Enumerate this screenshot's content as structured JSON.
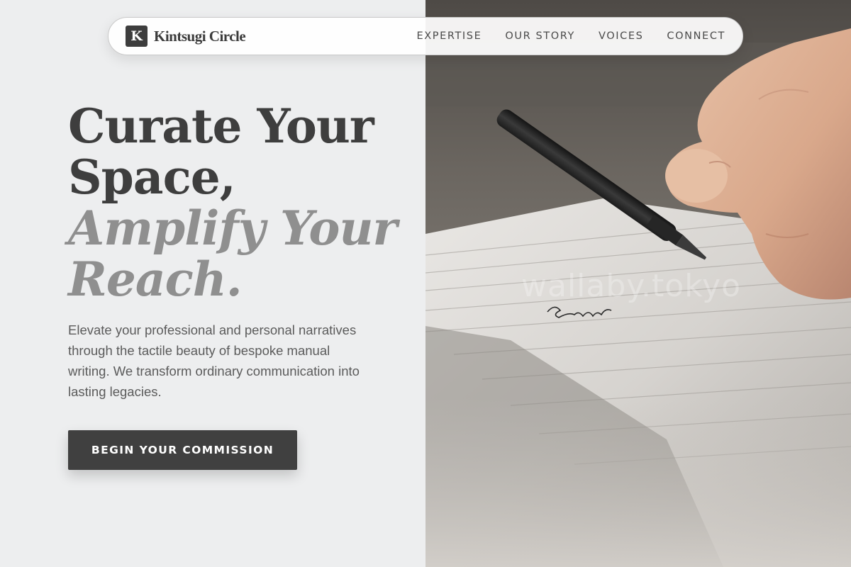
{
  "brand": {
    "logo_letter": "K",
    "name": "Kintsugi Circle"
  },
  "nav": {
    "items": [
      {
        "label": "EXPERTISE"
      },
      {
        "label": "OUR STORY"
      },
      {
        "label": "VOICES"
      },
      {
        "label": "CONNECT"
      }
    ]
  },
  "hero": {
    "title_line1": "Curate Your",
    "title_line2": "Space,",
    "title_line3": "Amplify Your",
    "title_line4": "Reach.",
    "description": "Elevate your professional and personal narratives through the tactile beauty of bespoke manual writing. We transform ordinary communication into lasting legacies.",
    "cta_label": "BEGIN YOUR COMMISSION"
  },
  "photo": {
    "watermark": "wallaby.tokyo",
    "handwriting": "Story ...",
    "icon": "hand-writing-with-pen-image"
  },
  "colors": {
    "background": "#edeeef",
    "text_dark": "#3e3e3e",
    "text_accent": "#8f8f8f",
    "button": "#404040"
  }
}
